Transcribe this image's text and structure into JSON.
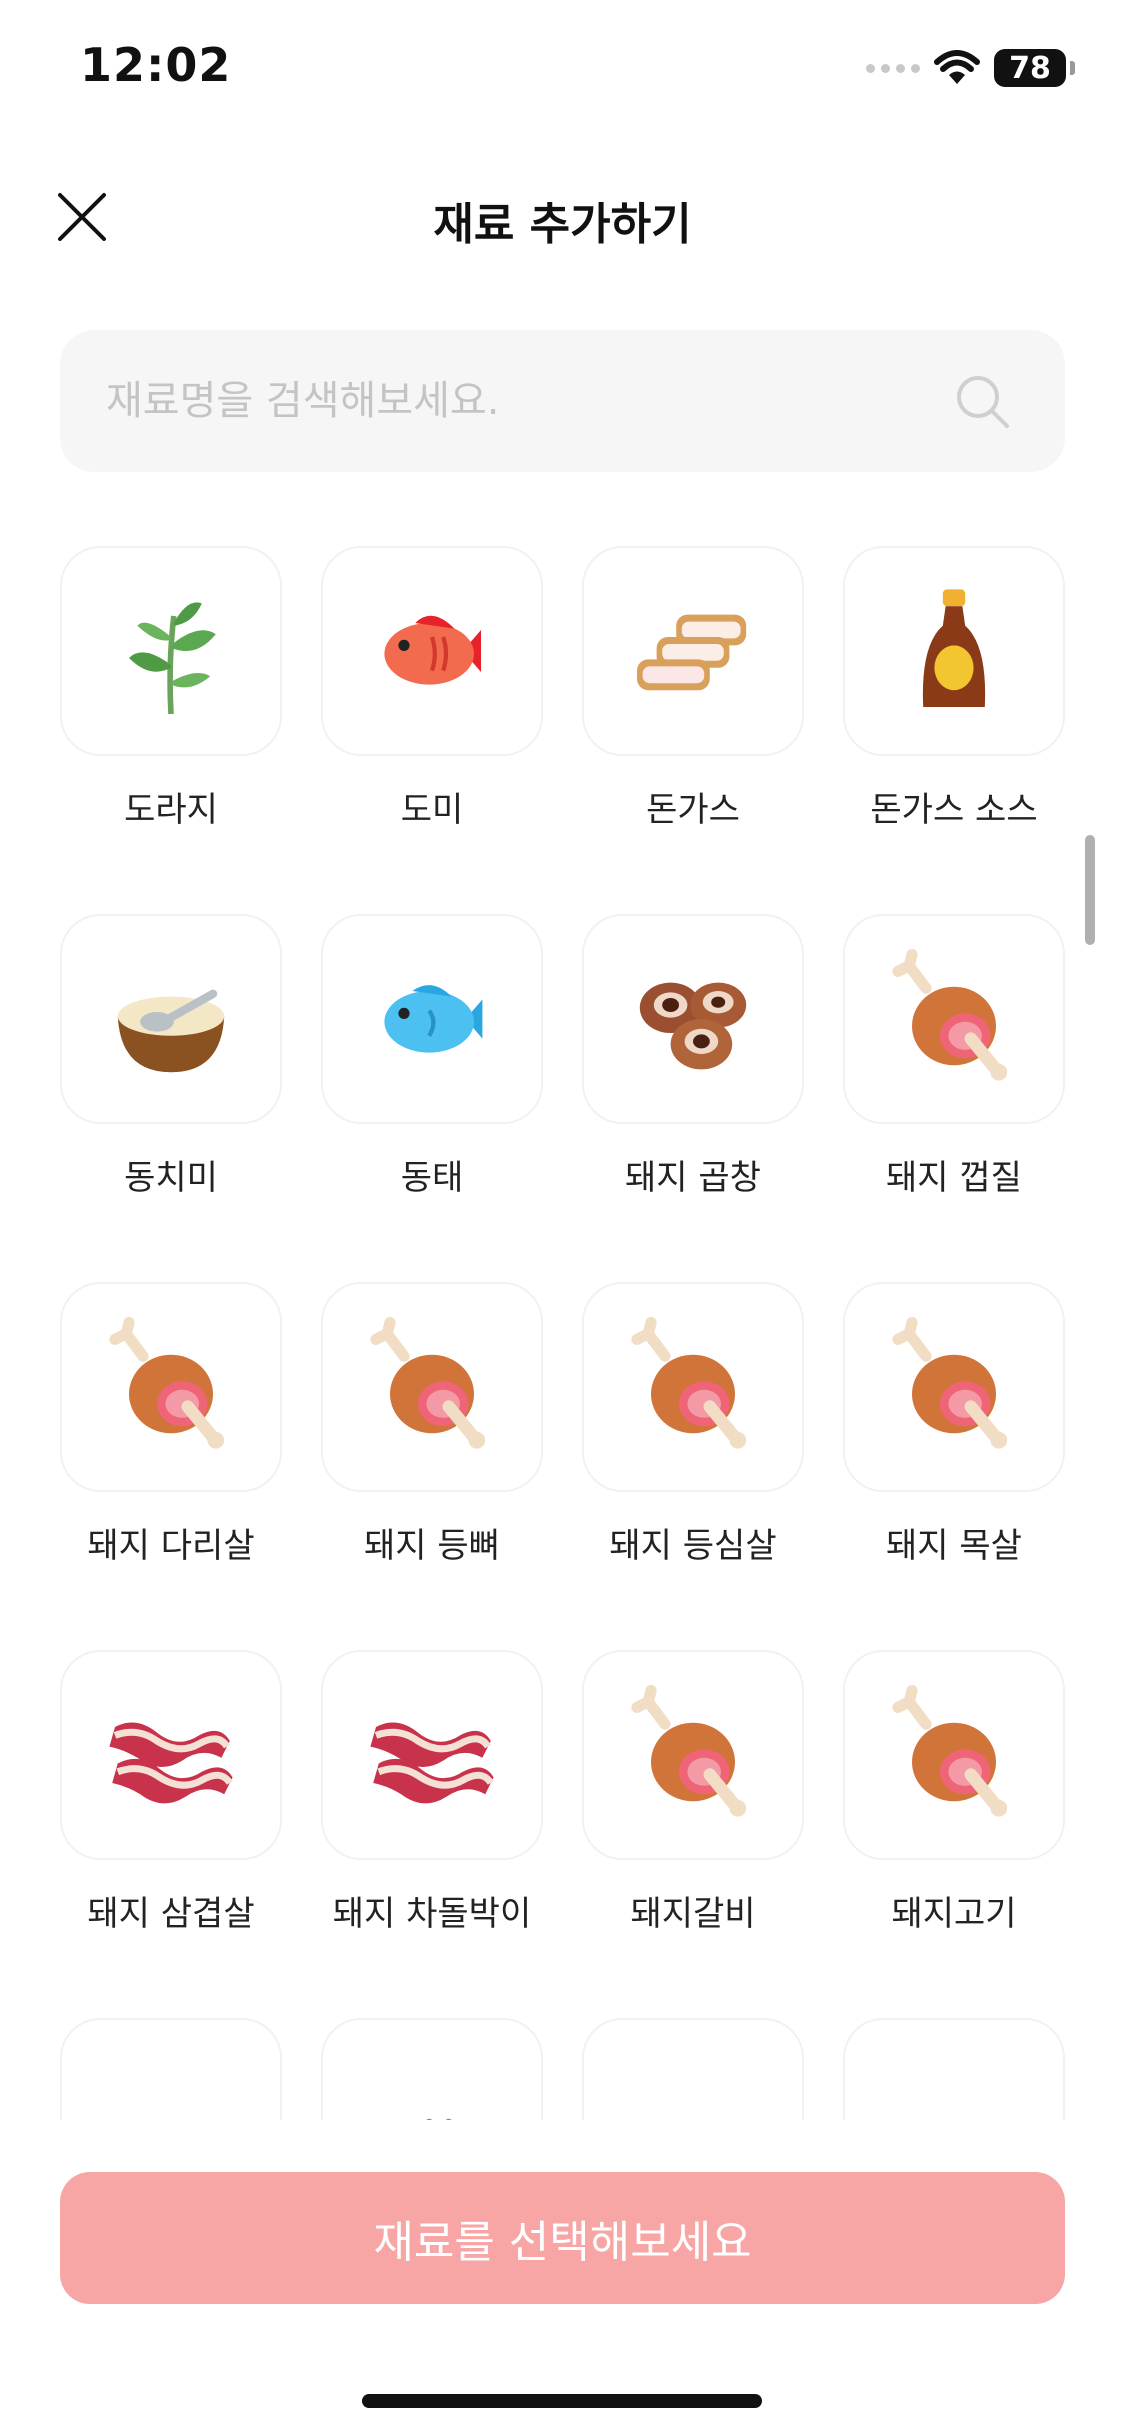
{
  "status": {
    "time": "12:02",
    "battery": "78"
  },
  "header": {
    "title": "재료 추가하기"
  },
  "search": {
    "placeholder": "재료명을 검색해보세요."
  },
  "items": [
    {
      "label": "도라지",
      "icon": "sprout-icon"
    },
    {
      "label": "도미",
      "icon": "red-fish-icon"
    },
    {
      "label": "돈가스",
      "icon": "cutlet-icon"
    },
    {
      "label": "돈가스 소스",
      "icon": "sauce-bottle-icon"
    },
    {
      "label": "동치미",
      "icon": "soup-bowl-icon"
    },
    {
      "label": "동태",
      "icon": "blue-fish-icon"
    },
    {
      "label": "돼지 곱창",
      "icon": "tripe-icon"
    },
    {
      "label": "돼지 껍질",
      "icon": "meat-leg-icon"
    },
    {
      "label": "돼지 다리살",
      "icon": "meat-leg-icon"
    },
    {
      "label": "돼지 등뼈",
      "icon": "meat-leg-icon"
    },
    {
      "label": "돼지 등심살",
      "icon": "meat-leg-icon"
    },
    {
      "label": "돼지 목살",
      "icon": "meat-leg-icon"
    },
    {
      "label": "돼지 삼겹살",
      "icon": "bacon-icon"
    },
    {
      "label": "돼지 차돌박이",
      "icon": "bacon-icon"
    },
    {
      "label": "돼지갈비",
      "icon": "meat-leg-icon"
    },
    {
      "label": "돼지고기",
      "icon": "meat-leg-icon"
    },
    {
      "label": "",
      "icon": "stew-bowl-icon"
    },
    {
      "label": "",
      "icon": "herb-icon"
    },
    {
      "label": "",
      "icon": "jar-icon"
    },
    {
      "label": "",
      "icon": "tofu-icon"
    }
  ],
  "cta": {
    "label": "재료를 선택해보세요"
  },
  "colors": {
    "cta_bg": "#f7a5a5",
    "tile_border": "#f1f1f1",
    "search_bg": "#f6f6f6"
  }
}
